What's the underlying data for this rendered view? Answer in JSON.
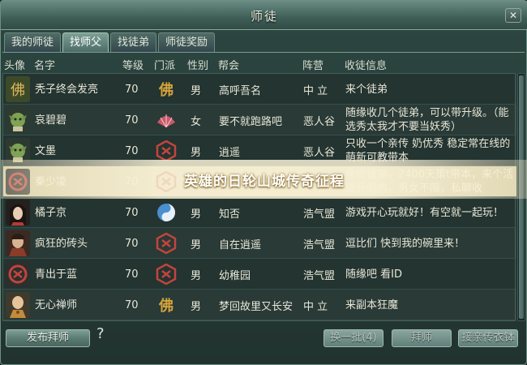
{
  "window": {
    "title": "师徒",
    "close_glyph": "✕"
  },
  "tabs": [
    {
      "label": "我的师徒",
      "active": false
    },
    {
      "label": "找师父",
      "active": true
    },
    {
      "label": "找徒弟",
      "active": false
    },
    {
      "label": "师徒奖励",
      "active": false
    }
  ],
  "columns": {
    "avatar": "头像",
    "name": "名字",
    "level": "等级",
    "sect": "门派",
    "gender": "性别",
    "guild": "帮会",
    "faction": "阵营",
    "message": "收徒信息"
  },
  "rows": [
    {
      "avatar": "monkey-avatar",
      "name": "秃子终会发亮",
      "level": "70",
      "sect": "佛",
      "sect_icon": "buddha-sect-icon",
      "gender": "男",
      "guild": "高呼吾名",
      "faction": "中 立",
      "message": "来个徒弟"
    },
    {
      "avatar": "goblin-avatar",
      "name": "哀碧碧",
      "level": "70",
      "sect": "扇",
      "sect_icon": "fan-sect-icon",
      "gender": "女",
      "guild": "要不就跑路吧",
      "faction": "恶人谷",
      "message": "随缘收几个徒弟，可以带升级。（能选秀太我才不要当妖秀）"
    },
    {
      "avatar": "goblin-avatar",
      "name": "文墨",
      "level": "70",
      "sect": "",
      "sect_icon": "red-emblem-sect-icon",
      "gender": "男",
      "guild": "逍遥",
      "faction": "恶人谷",
      "message": "只收一个亲传 奶优秀 稳定常在线的 萌新可教带本"
    },
    {
      "avatar": "emblem-avatar",
      "name": "秦少凌",
      "level": "70",
      "sect": "",
      "sect_icon": "red-emblem-sect-icon",
      "gender": "男",
      "guild": "",
      "faction": "",
      "message": "亲传徒弟，2400天策t带本，来个活泼开朗的，男女不限，私聊收"
    },
    {
      "avatar": "woman-avatar",
      "name": "橘子京",
      "level": "70",
      "sect": "",
      "sect_icon": "taiji-sect-icon",
      "gender": "男",
      "guild": "知否",
      "faction": "浩气盟",
      "message": "游戏开心玩就好！有空就一起玩！"
    },
    {
      "avatar": "warrior-avatar",
      "name": "疯狂的砖头",
      "level": "70",
      "sect": "",
      "sect_icon": "red-emblem-sect-icon",
      "gender": "男",
      "guild": "自在逍遥",
      "faction": "浩气盟",
      "message": "逗比们 快到我的碗里来！"
    },
    {
      "avatar": "emblem-avatar",
      "name": "青出于蓝",
      "level": "70",
      "sect": "",
      "sect_icon": "red-emblem-sect-icon",
      "gender": "男",
      "guild": "幼稚园",
      "faction": "浩气盟",
      "message": "随缘吧 看ID"
    },
    {
      "avatar": "monk-avatar",
      "name": "无心禅师",
      "level": "70",
      "sect": "佛",
      "sect_icon": "buddha-sect-icon",
      "gender": "男",
      "guild": "梦回故里又长安",
      "faction": "中 立",
      "message": "来副本狂魔"
    }
  ],
  "selected_row_index": 3,
  "watermark": "英雄的日轮山城传奇征程",
  "bottom": {
    "publish_button": "发布拜师",
    "help_glyph": "?",
    "refresh_button": "换一批(4)",
    "apprentice_button": "拜师",
    "legacy_button": "接亲传衣钵"
  },
  "colors": {
    "accent_gold": "#e6dcb2",
    "sect_red": "#c2443c",
    "sect_gold": "#d6a43b",
    "sect_blue": "#4a8fcf"
  }
}
